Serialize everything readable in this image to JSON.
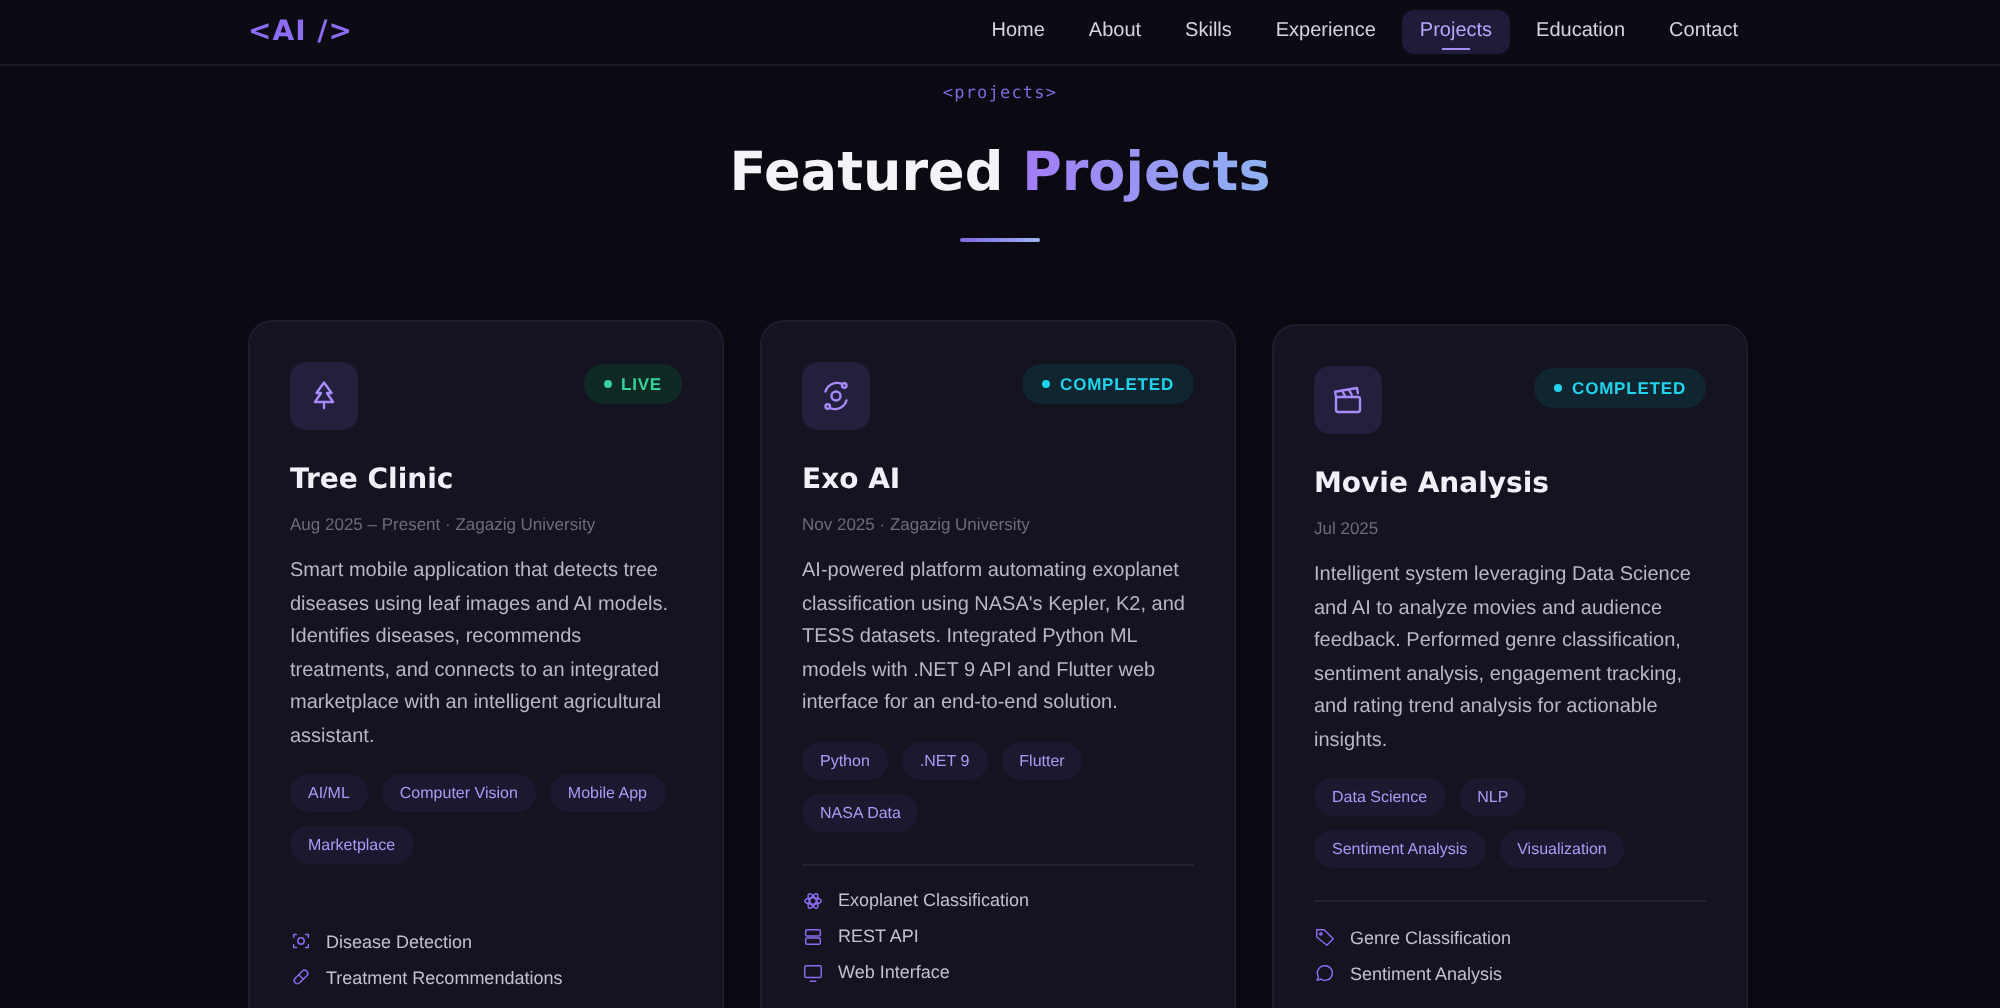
{
  "logo": "<AI />",
  "nav": [
    {
      "label": "Home",
      "selected": false
    },
    {
      "label": "About",
      "selected": false
    },
    {
      "label": "Skills",
      "selected": false
    },
    {
      "label": "Experience",
      "selected": false
    },
    {
      "label": "Projects",
      "selected": true
    },
    {
      "label": "Education",
      "selected": false
    },
    {
      "label": "Contact",
      "selected": false
    }
  ],
  "section": {
    "tag": "<projects>",
    "title": "Featured",
    "title_accent": "Projects"
  },
  "projects": [
    {
      "title": "Tree Clinic",
      "status": {
        "kind": "live",
        "label": "LIVE"
      },
      "meta": "Aug 2025 – Present · Zagazig University",
      "description": "Smart mobile application that detects tree diseases using leaf images and AI models. Identifies diseases, recommends treatments, and connects to an integrated marketplace with an intelligent agricultural assistant.",
      "tags": [
        "AI/ML",
        "Computer Vision",
        "Mobile App",
        "Marketplace"
      ],
      "features": [
        "Disease Detection",
        "Treatment Recommendations"
      ]
    },
    {
      "title": "Exo AI",
      "status": {
        "kind": "completed",
        "label": "COMPLETED"
      },
      "meta": "Nov 2025 · Zagazig University",
      "description": "AI-powered platform automating exoplanet classification using NASA's Kepler, K2, and TESS datasets. Integrated Python ML models with .NET 9 API and Flutter web interface for an end-to-end solution.",
      "tags": [
        "Python",
        ".NET 9",
        "Flutter",
        "NASA Data"
      ],
      "features": [
        "Exoplanet Classification",
        "REST API",
        "Web Interface"
      ]
    },
    {
      "title": "Movie Analysis",
      "status": {
        "kind": "completed",
        "label": "COMPLETED"
      },
      "meta": "Jul 2025",
      "description": "Intelligent system leveraging Data Science and AI to analyze movies and audience feedback. Performed genre classification, sentiment analysis, engagement tracking, and rating trend analysis for actionable insights.",
      "tags": [
        "Data Science",
        "NLP",
        "Sentiment Analysis",
        "Visualization"
      ],
      "features": [
        "Genre Classification",
        "Sentiment Analysis"
      ]
    }
  ]
}
